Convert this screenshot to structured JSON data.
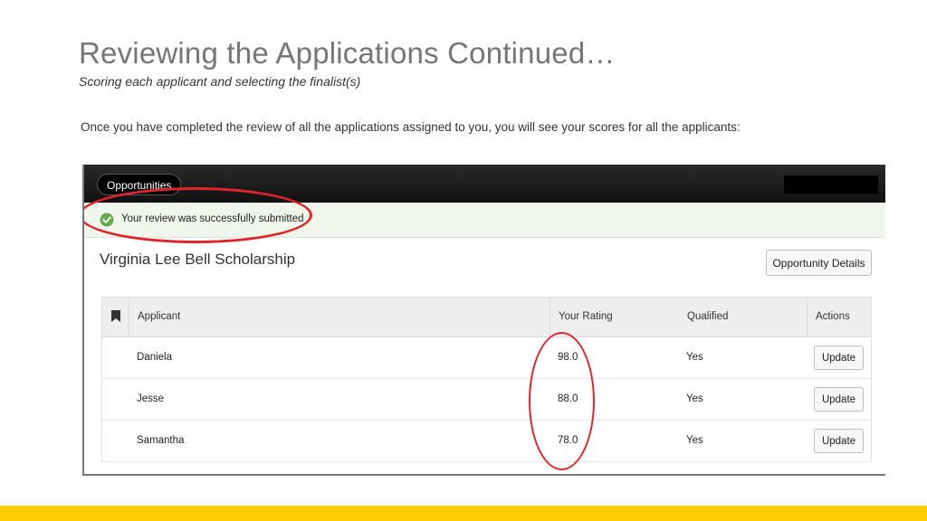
{
  "slide": {
    "title": "Reviewing the Applications Continued…",
    "subtitle": "Scoring each applicant and selecting the finalist(s)",
    "body": "Once you have completed the review of all the applications assigned to you, you will see your scores for all the applicants:"
  },
  "app": {
    "nav": {
      "opportunities_tab": "Opportunities"
    },
    "alert": {
      "message": "Your review was successfully submitted",
      "icon": "check-circle-icon",
      "color": "#6aa84f"
    },
    "page_title": "Virginia Lee Bell Scholarship",
    "details_button": "Opportunity Details",
    "table": {
      "headers": {
        "applicant": "Applicant",
        "rating": "Your Rating",
        "qualified": "Qualified",
        "actions": "Actions"
      },
      "rows": [
        {
          "applicant": "Daniela",
          "rating": "98.0",
          "qualified": "Yes",
          "action": "Update"
        },
        {
          "applicant": "Jesse",
          "rating": "88.0",
          "qualified": "Yes",
          "action": "Update"
        },
        {
          "applicant": "Samantha",
          "rating": "78.0",
          "qualified": "Yes",
          "action": "Update"
        }
      ]
    }
  },
  "colors": {
    "annotation": "#e0242b",
    "footer_accent": "#ffcc00",
    "title": "#767676"
  }
}
